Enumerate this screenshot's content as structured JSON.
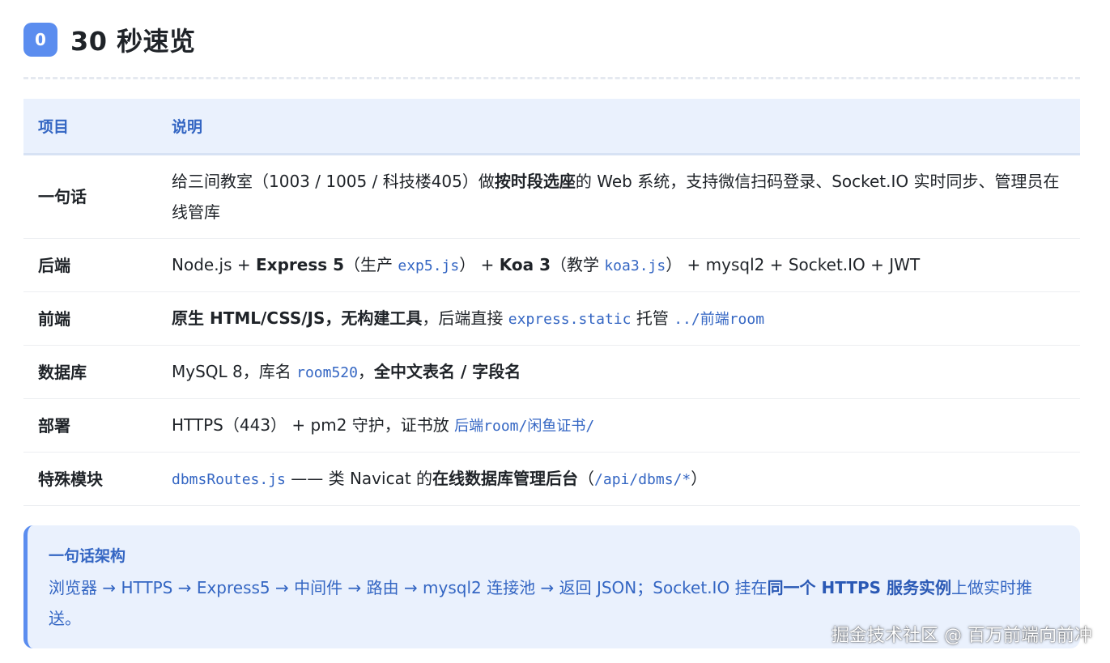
{
  "header": {
    "badge": "0",
    "title": "30 秒速览"
  },
  "table": {
    "headers": [
      "项目",
      "说明"
    ],
    "rows": [
      {
        "key": "一句话",
        "p1": "给三间教室（1003 / 1005 / 科技楼405）做",
        "b1": "按时段选座",
        "p2": "的 Web 系统，支持微信扫码登录、Socket.IO 实时同步、管理员在线管库"
      },
      {
        "key": "后端",
        "p1": "Node.js + ",
        "b1": "Express 5",
        "p2": "（生产 ",
        "c1": "exp5.js",
        "p3": "） + ",
        "b2": "Koa 3",
        "p4": "（教学 ",
        "c2": "koa3.js",
        "p5": "） + mysql2 + Socket.IO + JWT"
      },
      {
        "key": "前端",
        "b1": "原生 HTML/CSS/JS，无构建工具",
        "p1": "，后端直接 ",
        "c1": "express.static",
        "p2": " 托管 ",
        "c2": "../前端room"
      },
      {
        "key": "数据库",
        "p1": "MySQL 8，库名 ",
        "c1": "room520",
        "p2": "，",
        "b1": "全中文表名 / 字段名"
      },
      {
        "key": "部署",
        "p1": "HTTPS（443） + pm2 守护，证书放 ",
        "c1": "后端room/闲鱼证书/"
      },
      {
        "key": "特殊模块",
        "c1": "dbmsRoutes.js",
        "p1": " —— 类 Navicat 的",
        "b1": "在线数据库管理后台",
        "p2": "（",
        "c2": "/api/dbms/*",
        "p3": "）"
      }
    ]
  },
  "callout": {
    "title": "一句话架构",
    "p1": "浏览器 → HTTPS → Express5 → 中间件 → 路由 → mysql2 连接池 → 返回 JSON；Socket.IO 挂在",
    "b1": "同一个 HTTPS 服务实例",
    "p2": "上做实时推送。"
  },
  "watermark": "掘金技术社区 @ 百万前端向前冲",
  "colors": {
    "accent": "#5b8def",
    "link": "#3466c3",
    "header_bg": "#eaf1fd"
  }
}
